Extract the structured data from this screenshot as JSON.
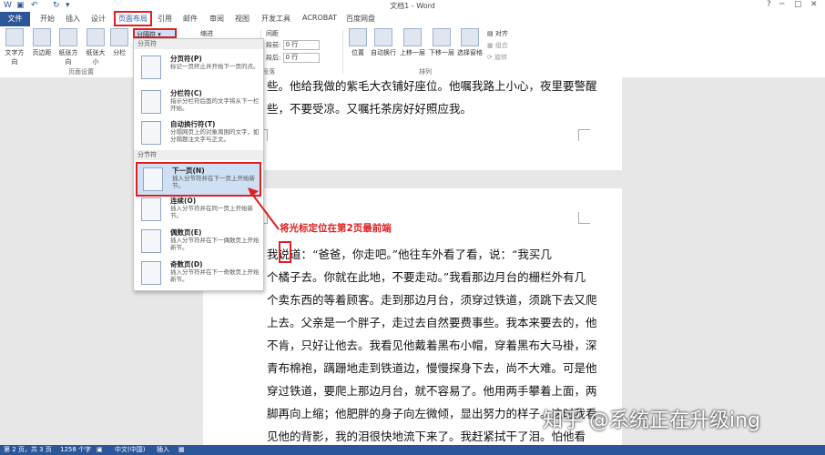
{
  "window": {
    "title": "文档1 - Word"
  },
  "tabs": {
    "file": "文件",
    "items": [
      "开始",
      "插入",
      "设计",
      "页面布局",
      "引用",
      "邮件",
      "审阅",
      "视图",
      "开发工具",
      "ACROBAT",
      "百度网盘"
    ]
  },
  "ribbon": {
    "buttons": [
      "文字方向",
      "页边距",
      "纸张方向",
      "纸张大小",
      "分栏"
    ],
    "breaks_button": "分隔符",
    "indent_label": "缩进",
    "spacing_label": "间距",
    "before_label": "段前:",
    "before_value": "0 行",
    "after_label": "段后:",
    "after_value": "0 行",
    "group_page_setup": "页面设置",
    "group_paragraph": "段落",
    "group_arrange": "排列",
    "arrange_buttons": [
      "位置",
      "自动换行",
      "上移一层",
      "下移一层",
      "选择窗格"
    ],
    "align": "对齐",
    "group": "组合",
    "rotate": "旋转"
  },
  "menu": {
    "section_page": "分页符",
    "section_section": "分节符",
    "items": [
      {
        "title": "分页符(P)",
        "desc": "标记一页终止并开始下一页的点。"
      },
      {
        "title": "分栏符(C)",
        "desc": "指示分栏符后面的文字将从下一栏开始。"
      },
      {
        "title": "自动换行符(T)",
        "desc": "分隔网页上的对象周围的文字，如分隔题注文字与正文。"
      },
      {
        "title": "下一页(N)",
        "desc": "插入分节符并在下一页上开始新节。"
      },
      {
        "title": "连续(O)",
        "desc": "插入分节符并在同一页上开始新节。"
      },
      {
        "title": "偶数页(E)",
        "desc": "插入分节符并在下一偶数页上开始新节。"
      },
      {
        "title": "奇数页(D)",
        "desc": "插入分节符并在下一奇数页上开始新节。"
      }
    ]
  },
  "document": {
    "page1_lines": [
      "些。他给我做的紫毛大衣铺好座位。他嘱我路上小心，夜里要警醒",
      "些，不要受凉。又嘱托茶房好好照应我。"
    ],
    "page2_lines": [
      "我说道：“爸爸，你走吧。”他往车外看了看，说：“我买几",
      "个橘子去。你就在此地，不要走动。”我看那边月台的栅栏外有几",
      "个卖东西的等着顾客。走到那边月台，须穿过铁道，须跳下去又爬",
      "上去。父亲是一个胖子，走过去自然要费事些。我本来要去的，他",
      "不肯，只好让他去。我看见他戴着黑布小帽，穿着黑布大马褂，深",
      "青布棉袍，蹒跚地走到铁道边，慢慢探身下去，尚不大难。可是他",
      "穿过铁道，要爬上那边月台，就不容易了。他用两手攀着上面，两",
      "脚再向上缩；他肥胖的身子向左微倾，显出努力的样子。这时我看",
      "见他的背影，我的泪很快地流下来了。我赶紧拭干了泪。怕他看"
    ]
  },
  "annotation": "将光标定位在第2页最前端",
  "status": {
    "page": "第 2 页，共 3 页",
    "words": "1258 个字",
    "lang": "中文(中国)",
    "mode": "插入"
  },
  "watermark": "知乎 @系统正在升级ing",
  "colors": {
    "accent": "#2b579a",
    "highlight": "#e02020"
  }
}
